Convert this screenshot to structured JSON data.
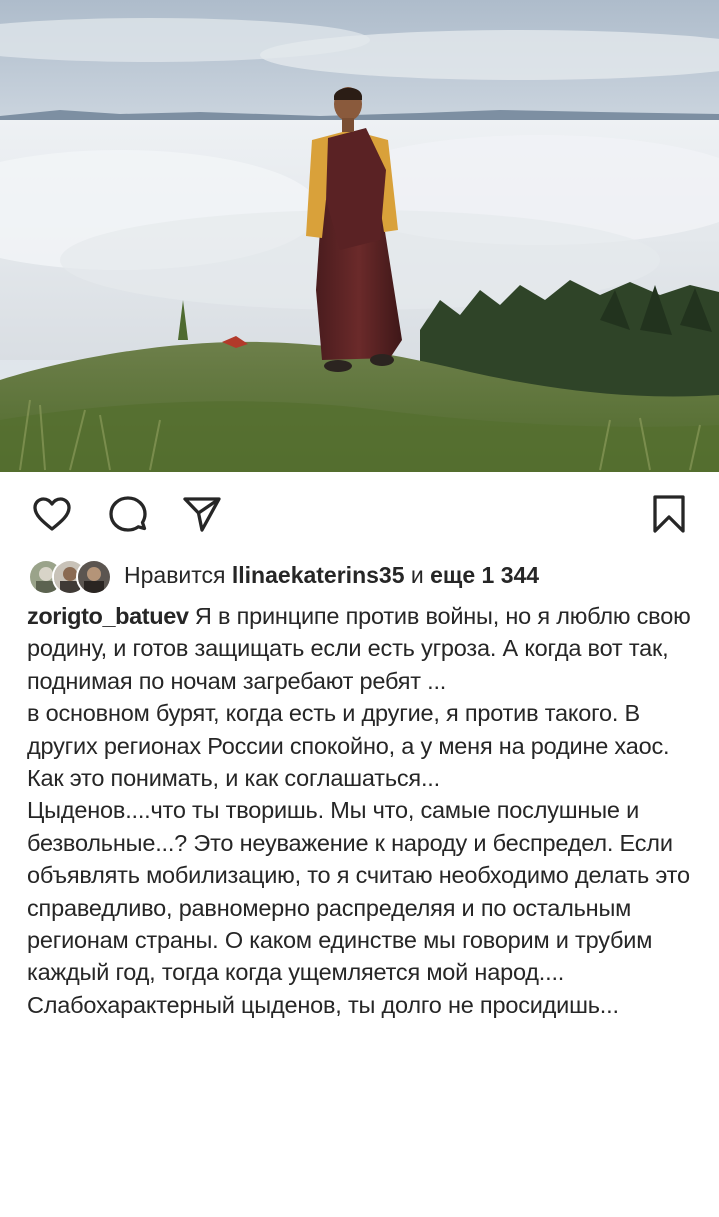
{
  "post": {
    "image": {
      "description_icon": "photo",
      "sky_color": "#c9d4de",
      "grass_color": "#5f7a3a"
    },
    "actions": {
      "like_icon": "heart-icon",
      "comment_icon": "comment-icon",
      "share_icon": "send-icon",
      "save_icon": "bookmark-icon"
    },
    "likes": {
      "prefix": "Нравится",
      "user": "llinaekaterins35",
      "middle": "и",
      "count_text": "еще 1 344"
    },
    "caption": {
      "username": "zorigto_batuev",
      "paragraphs": [
        "Я в принципе против войны, но я люблю свою родину, и готов защищать если есть угроза. А когда вот так, поднимая по ночам загребают ребят ...",
        "в основном бурят, когда есть и другие, я против такого. В других регионах России спокойно, а у меня на родине хаос. Как это понимать, и как соглашаться...",
        "Цыденов....что ты творишь. Мы что, самые послушные и безвольные...? Это неуважение к народу и беспредел. Если объявлять мобилизацию, то я считаю необходимо делать это справедливо, равномерно распределяя и по остальным регионам страны. О каком единстве мы говорим и трубим каждый год, тогда когда ущемляется мой народ.... Слабохарактерный цыденов, ты долго не просидишь..."
      ]
    }
  }
}
